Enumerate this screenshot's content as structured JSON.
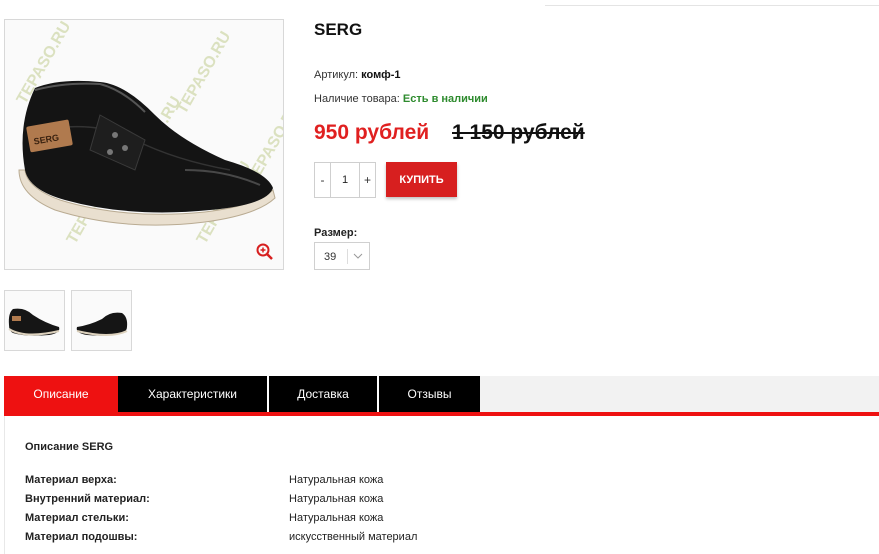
{
  "product": {
    "title": "SERG",
    "sku_label": "Артикул:",
    "sku_value": "комф-1",
    "stock_label": "Наличие товара:",
    "stock_value": "Есть в наличии",
    "price": "950 рублей",
    "old_price": "1 150 рублей",
    "quantity": "1",
    "qty_minus": "-",
    "qty_plus": "+",
    "buy_label": "КУПИТЬ",
    "size_label": "Размер:",
    "size_value": "39",
    "watermark": "TEPASO.RU",
    "shoe_brand": "SERG"
  },
  "tabs": [
    {
      "label": "Описание"
    },
    {
      "label": "Характеристики"
    },
    {
      "label": "Доставка"
    },
    {
      "label": "Отзывы"
    }
  ],
  "description": {
    "title": "Описание SERG",
    "specs": [
      {
        "key": "Материал верха:",
        "value": "Натуральная кожа"
      },
      {
        "key": "Внутренний материал:",
        "value": "Натуральная кожа"
      },
      {
        "key": "Материал стельки:",
        "value": "Натуральная кожа"
      },
      {
        "key": "Материал подошвы:",
        "value": "искусственный материал"
      }
    ]
  },
  "colors": {
    "accent": "#ee1111",
    "buy": "#d71f1f",
    "in_stock": "#2e8b2e"
  },
  "icons": {
    "zoom": "zoom-in-icon",
    "chevron": "chevron-down-icon"
  }
}
